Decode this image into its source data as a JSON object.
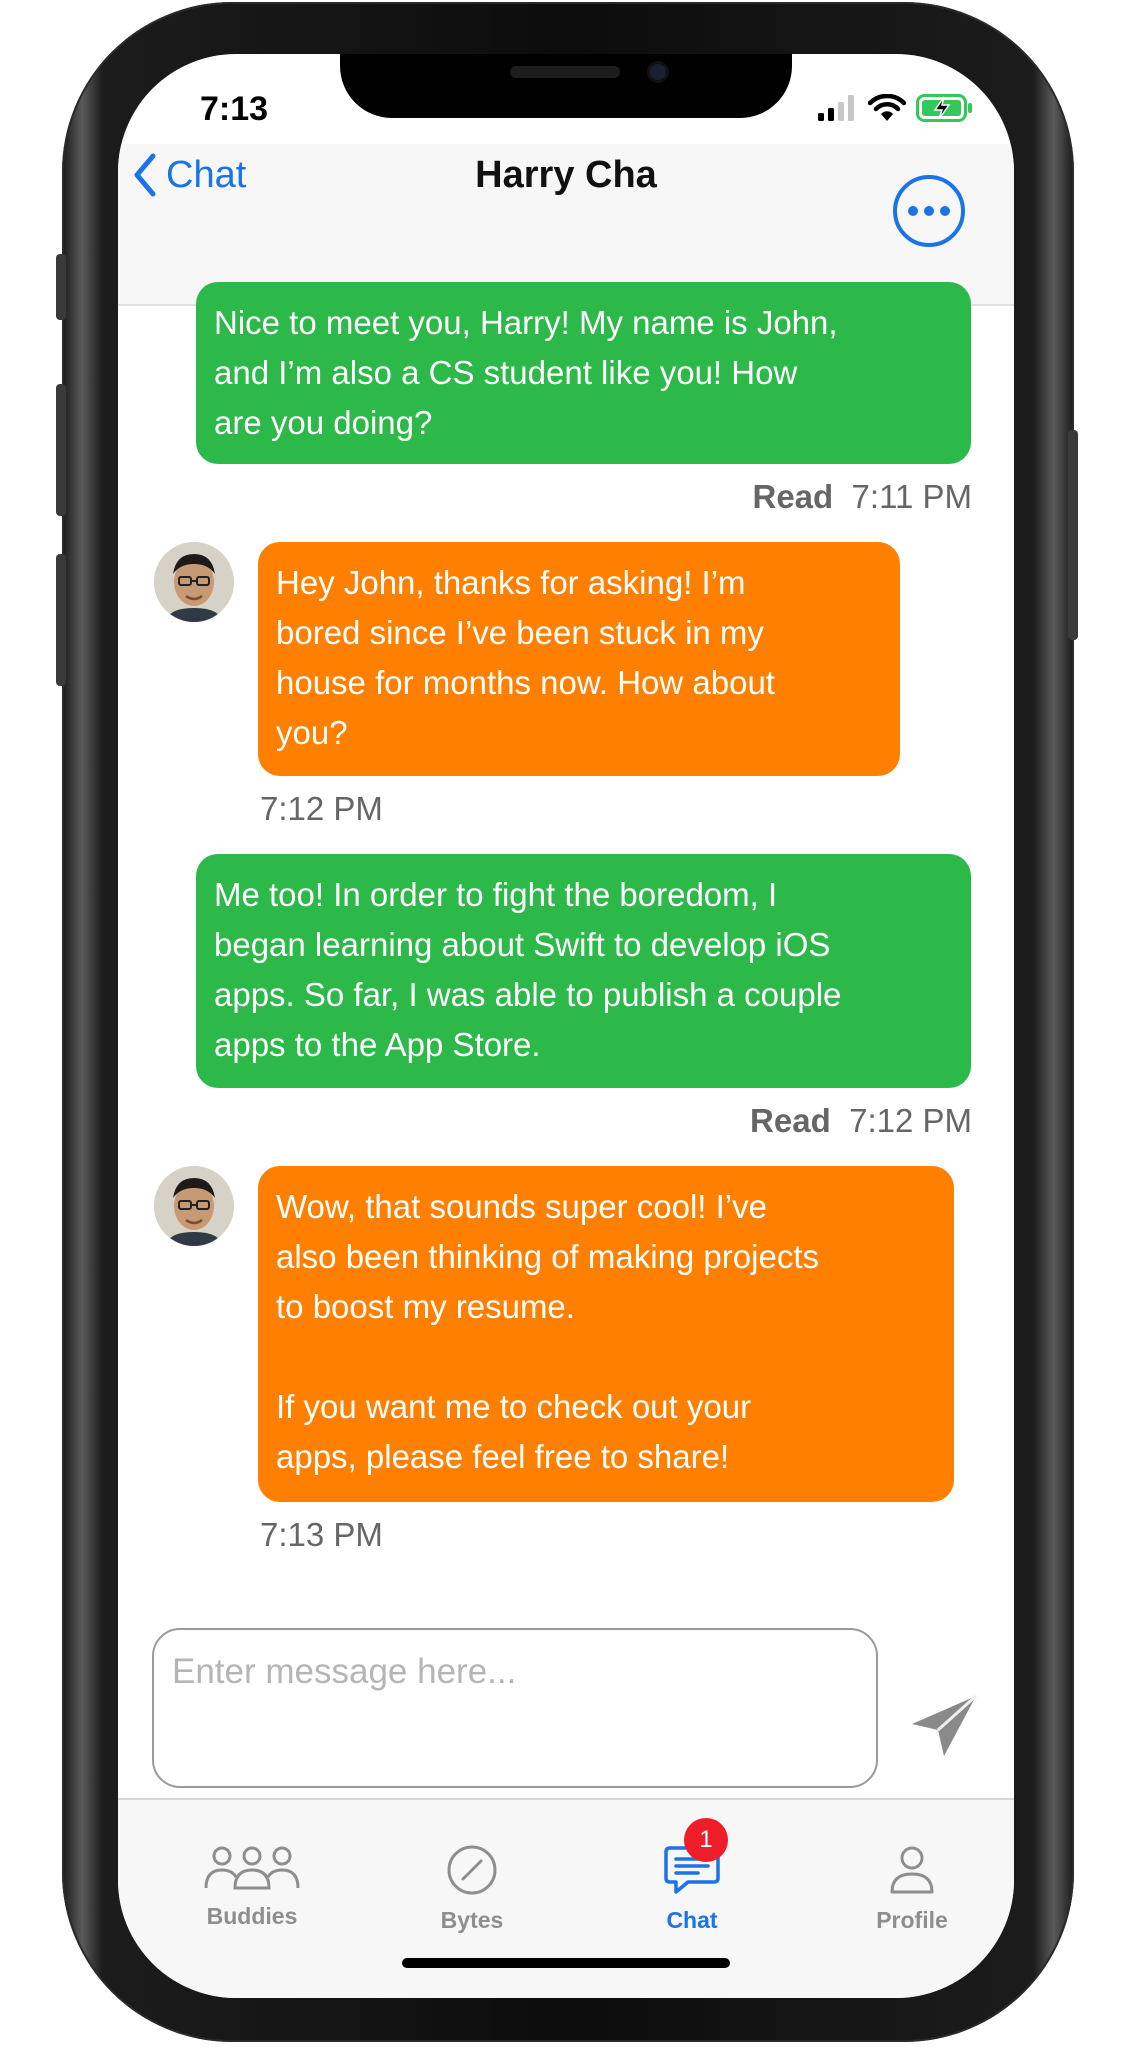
{
  "status_bar": {
    "time": "7:13"
  },
  "nav": {
    "back_label": "Chat",
    "title": "Harry Cha"
  },
  "messages": [
    {
      "sender": "me",
      "text": "Nice to meet you, Harry! My name is John,\nand I’m also a CS student like you! How\nare you doing?",
      "status": "Read",
      "time": "7:11 PM"
    },
    {
      "sender": "other",
      "text": "Hey John, thanks for asking! I’m\nbored since I’ve been stuck in my\nhouse for months now. How about\nyou?",
      "time": "7:12 PM"
    },
    {
      "sender": "me",
      "text": "Me too! In order to fight the boredom, I\nbegan learning about Swift to develop iOS\napps. So far, I was able to publish a couple\napps to the App Store.",
      "status": "Read",
      "time": "7:12 PM"
    },
    {
      "sender": "other",
      "text": "Wow, that sounds super cool! I’ve\nalso been thinking of making projects\nto boost my resume.\n\nIf you want me to check out your\napps, please feel free to share!",
      "time": "7:13 PM"
    }
  ],
  "composer": {
    "placeholder": "Enter message here..."
  },
  "tabbar": {
    "tabs": [
      {
        "label": "Buddies",
        "icon": "people-icon"
      },
      {
        "label": "Bytes",
        "icon": "compass-icon"
      },
      {
        "label": "Chat",
        "icon": "chat-bubble-icon",
        "active": true,
        "badge": "1"
      },
      {
        "label": "Profile",
        "icon": "person-icon"
      }
    ]
  },
  "colors": {
    "accent": "#1a73e8",
    "sent_bubble": "#2db84a",
    "received_bubble": "#ff8000",
    "badge": "#ee1d2a"
  }
}
